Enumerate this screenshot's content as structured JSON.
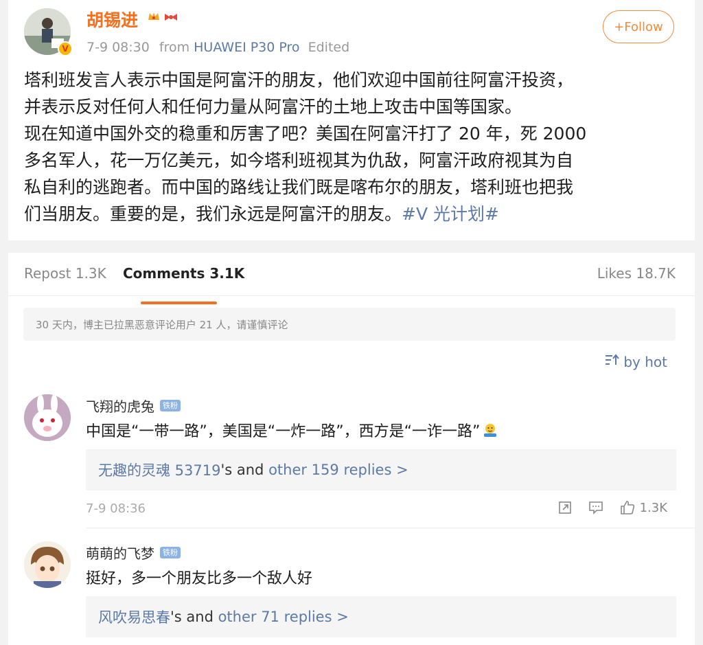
{
  "post": {
    "author": "胡锡进",
    "time": "7-9 08:30",
    "from_label": "from",
    "device": "HUAWEI P30 Pro",
    "edited": "Edited",
    "follow_label": "+Follow",
    "lines": [
      "塔利班发言人表示中国是阿富汗的朋友，他们欢迎中国前往阿富汗投资，",
      "并表示反对任何人和任何力量从阿富汗的土地上攻击中国等国家。",
      "现在知道中国外交的稳重和厉害了吧？美国在阿富汗打了 20 年，死 2000",
      "多名军人，花一万亿美元，如今塔利班视其为仇敌，阿富汗政府视其为自",
      "私自利的逃跑者。而中国的路线让我们既是喀布尔的朋友，塔利班也把我"
    ],
    "last_line": "们当朋友。重要的是，我们永远是阿富汗的朋友。",
    "hashtag": "#V 光计划#"
  },
  "tabs": {
    "repost": "Repost 1.3K",
    "comments": "Comments 3.1K",
    "likes": "Likes 18.7K"
  },
  "notice": "30 天内，博主已拉黑恶意评论用户 21 人，请谨慎评论",
  "sort_label": "by hot",
  "comments": [
    {
      "name": "飞翔的虎兔",
      "badge": "铁粉",
      "text": "中国是“一带一路”，美国是“一炸一路”，西方是“一诈一路”",
      "reply_user": "无趣的灵魂 53719",
      "reply_mid": "'s and ",
      "reply_more": "other 159 replies >",
      "time": "7-9 08:36",
      "likes": "1.3K"
    },
    {
      "name": "萌萌的飞梦",
      "badge": "铁粉",
      "text": "挺好，多一个朋友比多一个敌人好",
      "reply_user": "风吹易思春",
      "reply_mid": "'s and ",
      "reply_more": "other 71 replies >"
    }
  ],
  "colors": {
    "accent": "#f76e1c",
    "link": "#5b7aa8"
  }
}
